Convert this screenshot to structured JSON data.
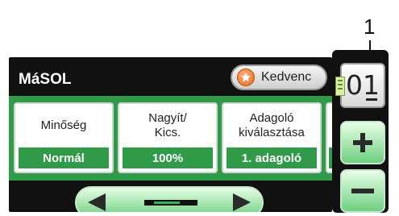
{
  "callout": {
    "number": "1"
  },
  "lcd": {
    "title": "MáSOL",
    "favorite_button": {
      "label": "Kedvenc",
      "icon": "star-icon"
    },
    "options": [
      {
        "label": "Minőség",
        "value": "Normál"
      },
      {
        "label": "Nagyít/\nKics.",
        "value": "100%"
      },
      {
        "label": "Adagoló\nkiválasztása",
        "value": "1. adagoló"
      }
    ],
    "navigation": {
      "left_icon": "arrow-left-icon",
      "right_icon": "arrow-right-icon",
      "scroll_position": 0.25
    }
  },
  "side_panel": {
    "copy_count": "01",
    "plus_icon": "plus-icon",
    "minus_icon": "minus-icon"
  },
  "colors": {
    "accent_green": "#2f9a48",
    "panel_black": "#111111",
    "favorite_orange": "#e8641c"
  }
}
